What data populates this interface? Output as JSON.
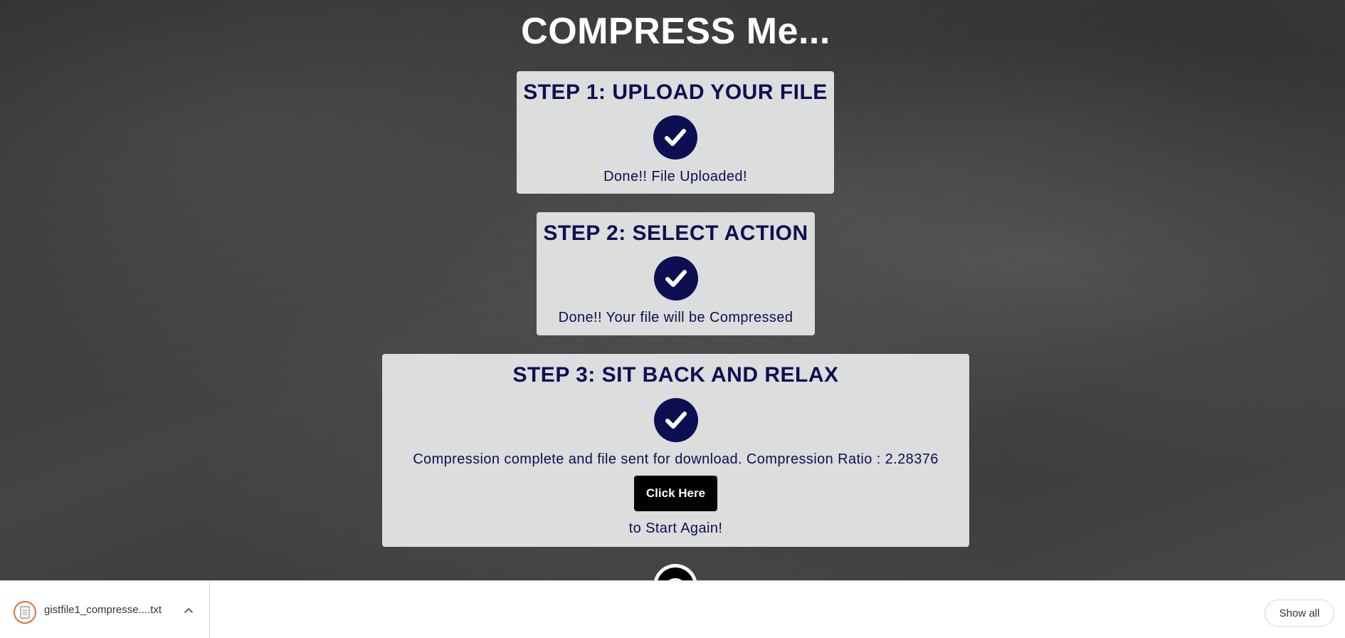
{
  "site": {
    "title": "COMPRESS Me..."
  },
  "steps": [
    {
      "title": "STEP 1: UPLOAD YOUR FILE",
      "status_icon": "check-icon",
      "message": "Done!! File Uploaded!"
    },
    {
      "title": "STEP 2: SELECT ACTION",
      "status_icon": "check-icon",
      "message": "Done!! Your file will be Compressed"
    },
    {
      "title": "STEP 3: SIT BACK AND RELAX",
      "status_icon": "check-icon",
      "message": "Compression complete and file sent for download. Compression Ratio : 2.28376",
      "button_label": "Click Here",
      "after_button": "to Start Again!"
    }
  ],
  "footer_badge": {
    "icon": "github-icon"
  },
  "download_bar": {
    "file_name": "gistfile1_compresse....txt",
    "file_icon": "text-file-icon",
    "menu_icon": "chevron-up-icon",
    "show_all_label": "Show all"
  },
  "colors": {
    "navy": "#0d0f52",
    "card_bg": "#dcdddd",
    "chalkboard": "#3a3a3c",
    "file_icon_accent": "#d9703c"
  }
}
